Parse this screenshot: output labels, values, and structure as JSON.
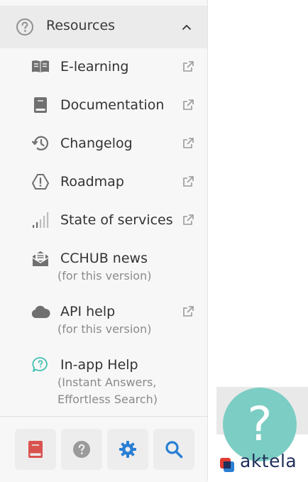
{
  "section": {
    "title": "Resources",
    "expanded": true
  },
  "items": [
    {
      "label": "E-learning",
      "external": true
    },
    {
      "label": "Documentation",
      "external": true
    },
    {
      "label": "Changelog",
      "external": true
    },
    {
      "label": "Roadmap",
      "external": true
    },
    {
      "label": "State of services",
      "external": true
    },
    {
      "label": "CCHUB news",
      "subtitle": "(for this version)",
      "external": false
    },
    {
      "label": "API help",
      "subtitle": "(for this version)",
      "external": true
    },
    {
      "label": "In-app Help",
      "subtitle_line1": "(Instant Answers,",
      "subtitle_line2": "Effortless Search)",
      "external": false
    }
  ],
  "toolbar": {
    "buttons": [
      {
        "icon": "book-icon",
        "color": "#d9534f"
      },
      {
        "icon": "question-circle-icon",
        "color": "#9a9a9a"
      },
      {
        "icon": "gear-icon",
        "color": "#2a7fd4"
      },
      {
        "icon": "search-icon",
        "color": "#2a7fd4"
      }
    ]
  },
  "help_widget": {
    "symbol": "?",
    "color": "#7ccdc4"
  },
  "brand": {
    "name": "aktela",
    "accent_red": "#e03c31",
    "accent_blue": "#2a7fd4"
  }
}
